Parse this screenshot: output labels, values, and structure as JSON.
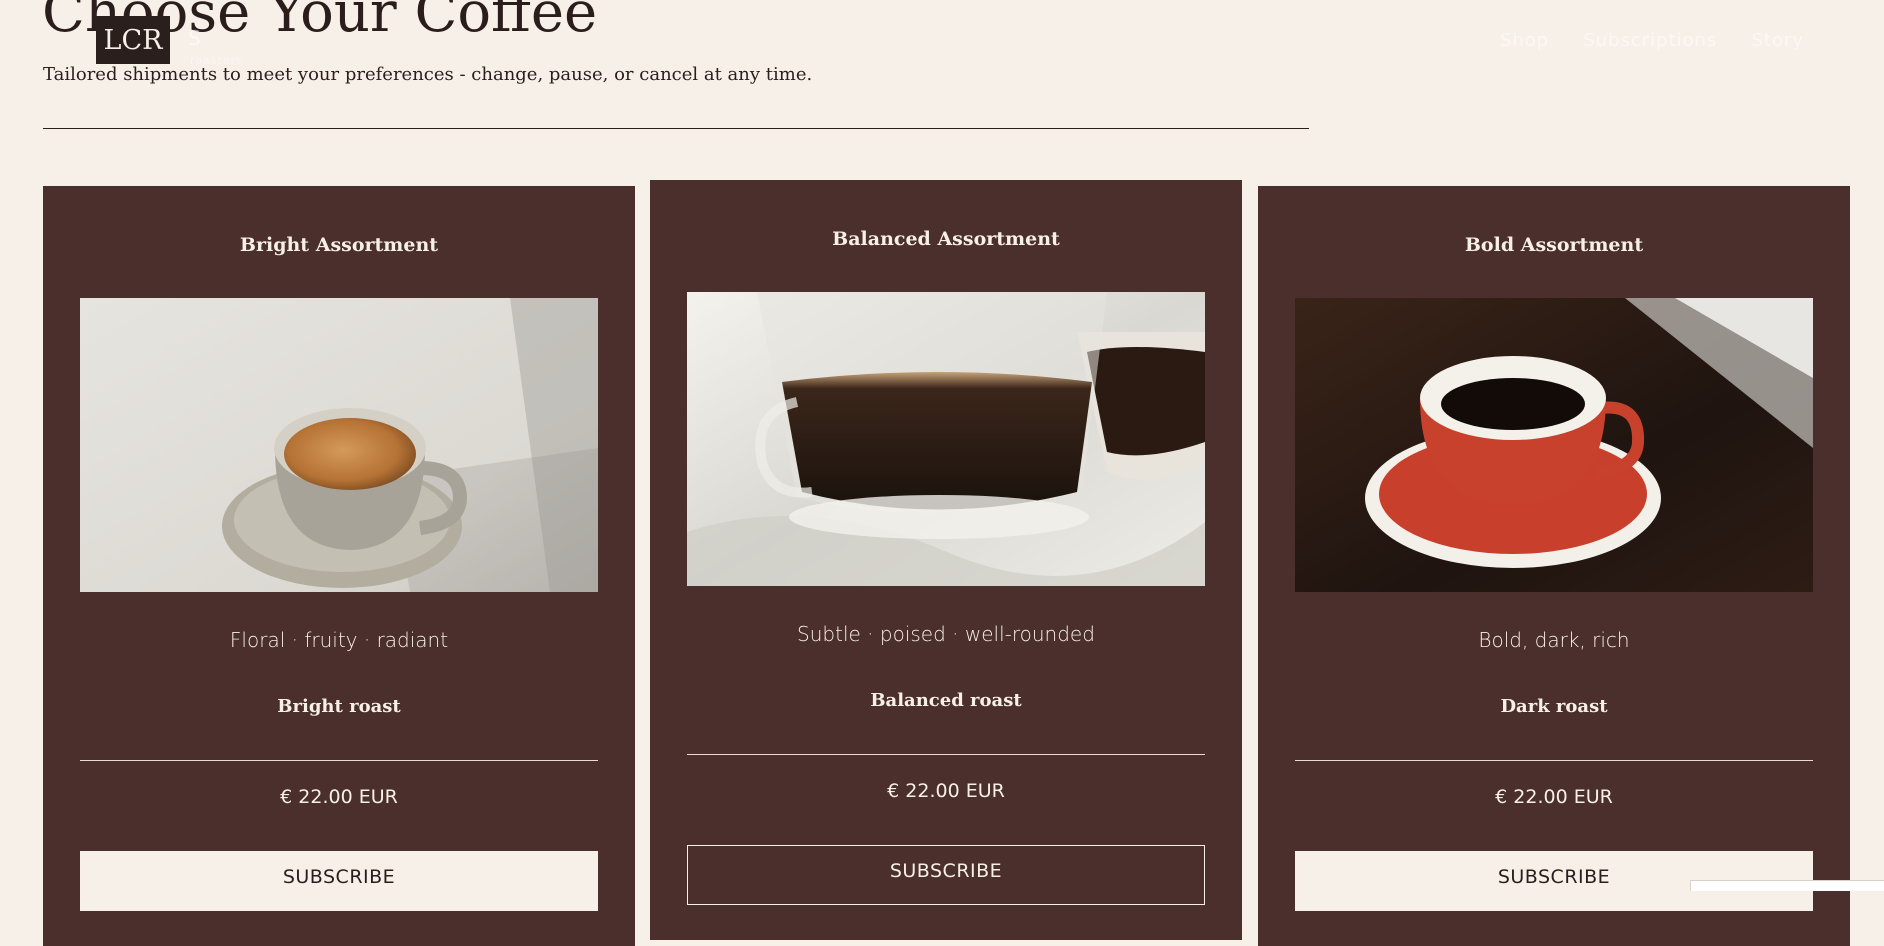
{
  "header": {
    "logo_text": "LCR",
    "logo_script": "S",
    "logo_tagline": "roasters",
    "nav": [
      "Shop",
      "Subscriptions",
      "Story"
    ]
  },
  "page": {
    "title": "Choose Your Coffee",
    "subtitle": "Tailored shipments to meet your preferences - change, pause, or cancel at any time."
  },
  "cards": [
    {
      "title": "Bright Assortment",
      "image": "espresso-cup-light-saucer",
      "tagline": "Floral · fruity · radiant",
      "roast": "Bright roast",
      "price": "€ 22.00 EUR",
      "cta": "SUBSCRIBE"
    },
    {
      "title": "Balanced Assortment",
      "image": "glass-coffee-cups",
      "tagline": "Subtle · poised · well-rounded",
      "roast": "Balanced roast",
      "price": "€ 22.00 EUR",
      "cta": "SUBSCRIBE"
    },
    {
      "title": "Bold Assortment",
      "image": "red-coffee-cup-dark-table",
      "tagline": "Bold, dark, rich",
      "roast": "Dark roast",
      "price": "€ 22.00 EUR",
      "cta": "SUBSCRIBE"
    }
  ],
  "colors": {
    "page_background": "#f7f0e8",
    "card_background": "#4a2f2c",
    "text_dark": "#2a1d1b",
    "text_light": "#f7f0e8"
  }
}
